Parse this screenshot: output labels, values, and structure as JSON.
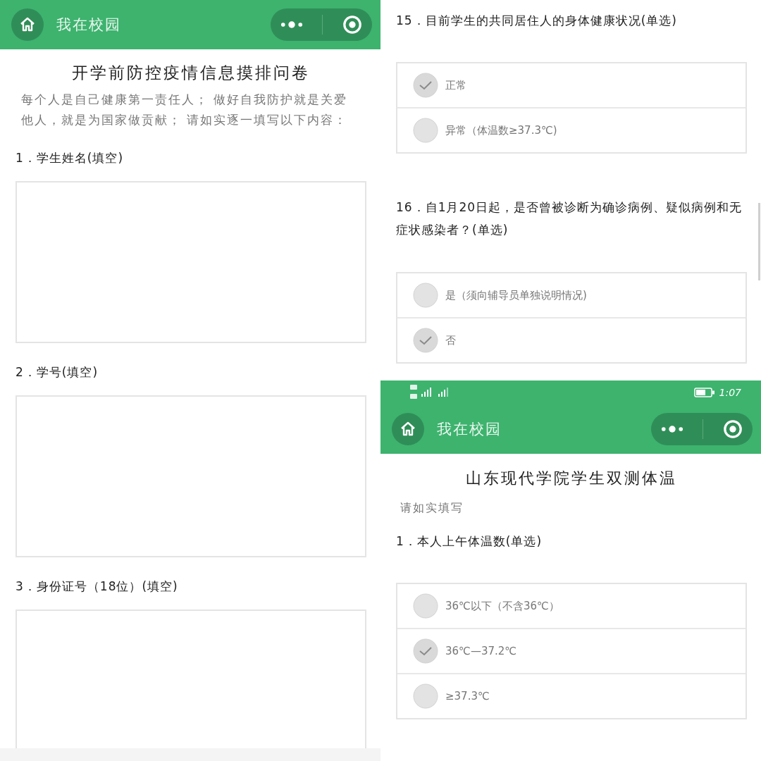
{
  "screens": [
    {
      "nav_bar": {
        "title": "我在校园"
      },
      "form_title": "开学前防控疫情信息摸排问卷",
      "intro": "每个人是自己健康第一责任人； 做好自我防护就是关爱他人，就是为国家做贡献； 请如实逐一填写以下内容：",
      "questions": [
        {
          "kind": "text",
          "label": "1．学生姓名(填空)"
        },
        {
          "kind": "text",
          "label": "2．学号(填空)"
        },
        {
          "kind": "text",
          "label": "3．身份证号（18位）(填空)"
        }
      ]
    },
    {
      "questions": [
        {
          "kind": "choice",
          "label": "15．目前学生的共同居住人的身体健康状况(单选)",
          "options": [
            {
              "label": "正常",
              "selected": true
            },
            {
              "label": "异常（体温数≥37.3℃)",
              "selected": false
            }
          ]
        },
        {
          "kind": "choice",
          "label": "16．自1月20日起，是否曾被诊断为确诊病例、疑似病例和无症状感染者？(单选)",
          "options": [
            {
              "label": "是（须向辅导员单独说明情况)",
              "selected": false
            },
            {
              "label": "否",
              "selected": true
            }
          ]
        }
      ]
    },
    {
      "status_bar": {
        "time": "1:07"
      },
      "nav_bar": {
        "title": "我在校园"
      },
      "form_title": "山东现代学院学生双测体温",
      "intro": "请如实填写",
      "questions": [
        {
          "kind": "choice",
          "label": "1．本人上午体温数(单选)",
          "options": [
            {
              "label": "36℃以下（不含36℃）",
              "selected": false
            },
            {
              "label": "36℃—37.2℃",
              "selected": true
            },
            {
              "label": "≥37.3℃",
              "selected": false
            }
          ]
        }
      ]
    }
  ]
}
